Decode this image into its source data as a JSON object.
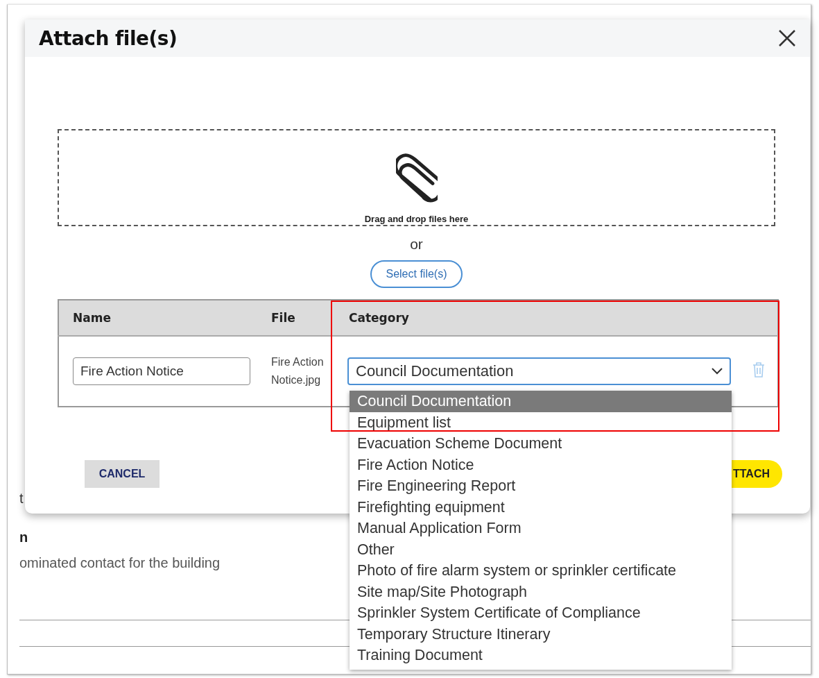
{
  "background": {
    "fragment_1": "t",
    "heading": "n",
    "text": "ominated contact for the building"
  },
  "dialog": {
    "title": "Attach file(s)",
    "drop_zone": {
      "hint": "Drag and drop files here",
      "separator": "or",
      "select_button": "Select file(s)"
    },
    "table": {
      "columns": [
        "Name",
        "File",
        "Category"
      ],
      "rows": [
        {
          "name": "Fire Action Notice",
          "file": "Fire Action Notice.jpg",
          "category": "Council Documentation"
        }
      ]
    },
    "buttons": {
      "cancel": "CANCEL",
      "attach": "TTACH"
    }
  },
  "dropdown": {
    "options": [
      {
        "label": "Council Documentation",
        "selected": true
      },
      {
        "label": "Equipment list",
        "selected": false
      },
      {
        "label": "Evacuation Scheme Document",
        "selected": false
      },
      {
        "label": "Fire Action Notice",
        "selected": false
      },
      {
        "label": "Fire Engineering Report",
        "selected": false
      },
      {
        "label": "Firefighting equipment",
        "selected": false
      },
      {
        "label": "Manual Application Form",
        "selected": false
      },
      {
        "label": "Other",
        "selected": false
      },
      {
        "label": "Photo of fire alarm system or sprinkler certificate",
        "selected": false
      },
      {
        "label": "Site map/Site Photograph",
        "selected": false
      },
      {
        "label": "Sprinkler System Certificate of Compliance",
        "selected": false
      },
      {
        "label": "Temporary Structure Itinerary",
        "selected": false
      },
      {
        "label": "Training Document",
        "selected": false
      }
    ]
  }
}
